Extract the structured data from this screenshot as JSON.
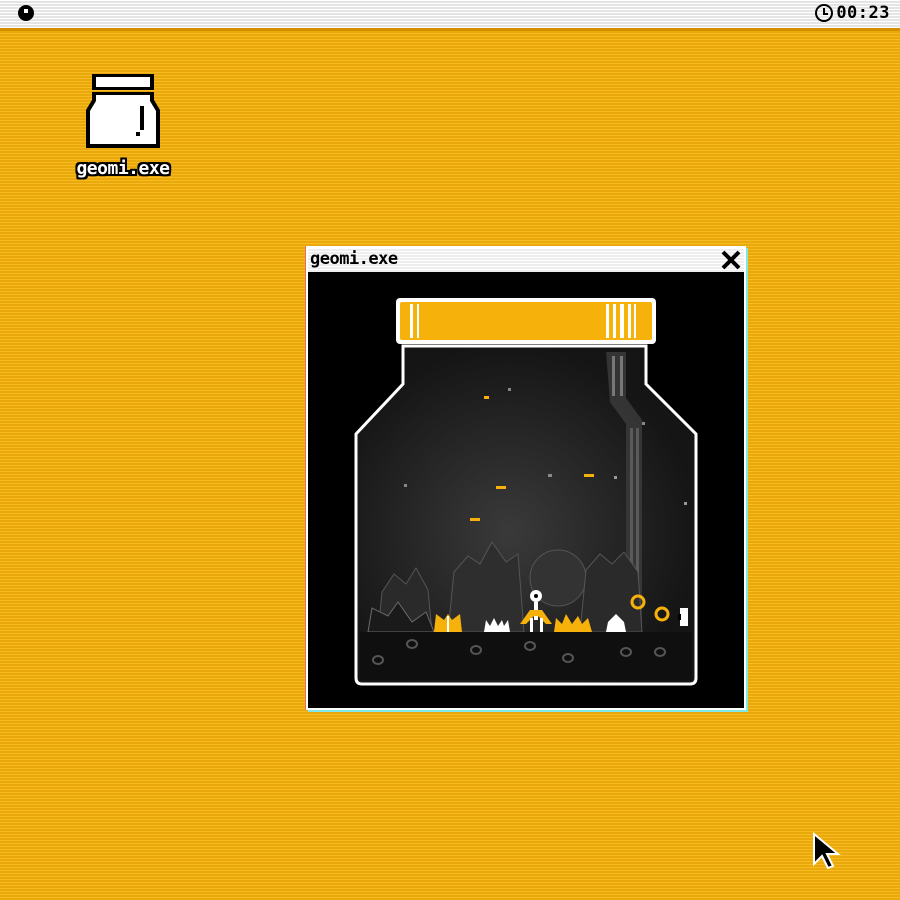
{
  "menubar": {
    "logo_icon": "dot-icon",
    "clock_icon": "clock-icon",
    "time": "00:23"
  },
  "desktop": {
    "background_color": "#f6b20a",
    "icons": [
      {
        "label": "geomi.exe",
        "icon": "jar-icon"
      }
    ]
  },
  "window": {
    "title": "geomi.exe",
    "close_icon": "close-icon",
    "content": "jar-terrarium-scene",
    "accent_color": "#f6b20a"
  },
  "cursor": {
    "icon": "arrow-cursor-icon"
  }
}
